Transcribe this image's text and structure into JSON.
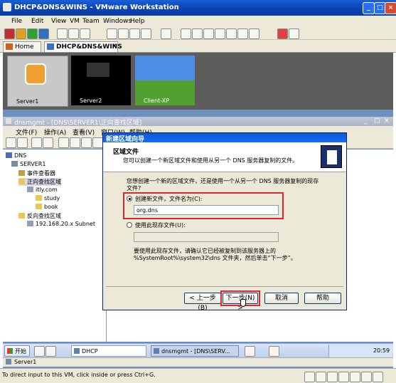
{
  "vmware": {
    "title": "DHCP&DNS&WINS - VMware Workstation",
    "menu": [
      "File",
      "Edit",
      "View",
      "VM",
      "Team",
      "Windows",
      "Help"
    ],
    "tabs": [
      "Home",
      "DHCP&DNS&WINS"
    ],
    "thumbnails": [
      "Server1",
      "Server2",
      "Client-XP"
    ],
    "status_text": "To direct input to this VM, click inside or press Ctrl+G."
  },
  "mmc": {
    "title": "dnsmgmt - [DNS\\SERVER1\\正向查找区域]",
    "menu": [
      "文件(F)",
      "操作(A)",
      "查看(V)",
      "窗口(W)",
      "帮助(H)"
    ],
    "tree": [
      {
        "label": "DNS",
        "level": 0
      },
      {
        "label": "SERVER1",
        "level": 1
      },
      {
        "label": "事件查看器",
        "level": 2
      },
      {
        "label": "正向查找区域",
        "level": 2
      },
      {
        "label": "itly.com",
        "level": 3
      },
      {
        "label": "study",
        "level": 4
      },
      {
        "label": "book",
        "level": 4
      },
      {
        "label": "反向查找区域",
        "level": 2
      },
      {
        "label": "192.168.20.x Subnet",
        "level": 3
      }
    ],
    "status": "Server1"
  },
  "wizard": {
    "title": "新建区域向导",
    "header_title": "区域文件",
    "header_desc": "您可以创建一个新区域文件和使用从另一个 DNS 服务器复制的文件。",
    "question": "您想创建一个新的区域文件，还是使用一个从另一个 DNS 服务器复制的现存文件?",
    "option_new": "创建新文件，文件名为(C):",
    "filename": "org.dns",
    "option_existing": "使用此现存文件(U):",
    "existing_value": "",
    "note": "要使用此现存文件，请确认它已经被复制到该服务器上的 %SystemRoot%\\system32\\dns 文件夹，然后单击“下一步”。",
    "back": "< 上一步(B)",
    "next": "下一步(N) >",
    "cancel": "取消",
    "help": "帮助"
  },
  "taskbar": {
    "start": "开始",
    "items": [
      "DHCP",
      "dnsmgmt - [DNS\\SERV..."
    ],
    "clock": "20:59"
  },
  "colors": {
    "highlight": "#e0262c",
    "xp_blue": "#0a58d8"
  }
}
